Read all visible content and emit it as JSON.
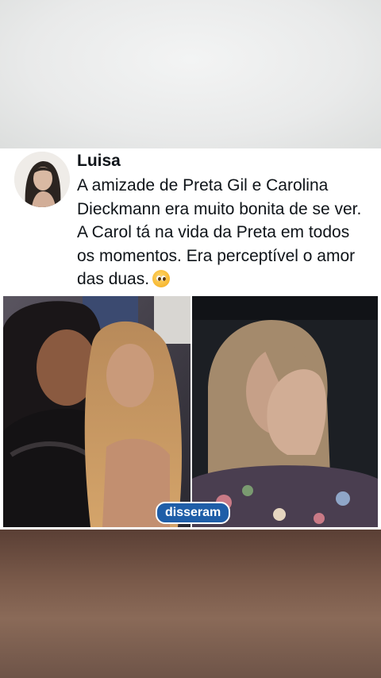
{
  "post": {
    "author": "Luisa",
    "text": "A amizade de Preta Gil e Carolina Dieckmann era muito bonita de se ver. A Carol tá na vida da Preta em todos os momentos. Era perceptível o amor das duas.",
    "emoji": "pleading-face",
    "badge": "disseram"
  },
  "colors": {
    "badge_bg": "#1f5ea8",
    "text": "#0f1419"
  }
}
